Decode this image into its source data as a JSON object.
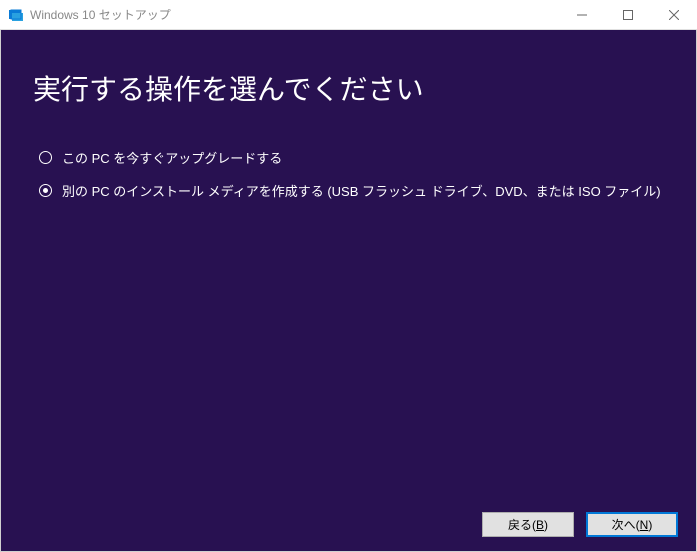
{
  "window": {
    "title": "Windows 10 セットアップ"
  },
  "heading": "実行する操作を選んでください",
  "options": [
    {
      "label": "この PC を今すぐアップグレードする",
      "selected": false
    },
    {
      "label": "別の PC のインストール メディアを作成する (USB フラッシュ ドライブ、DVD、または ISO ファイル)",
      "selected": true
    }
  ],
  "buttons": {
    "back_prefix": "戻る(",
    "back_accel": "B",
    "back_suffix": ")",
    "next_prefix": "次へ(",
    "next_accel": "N",
    "next_suffix": ")"
  }
}
